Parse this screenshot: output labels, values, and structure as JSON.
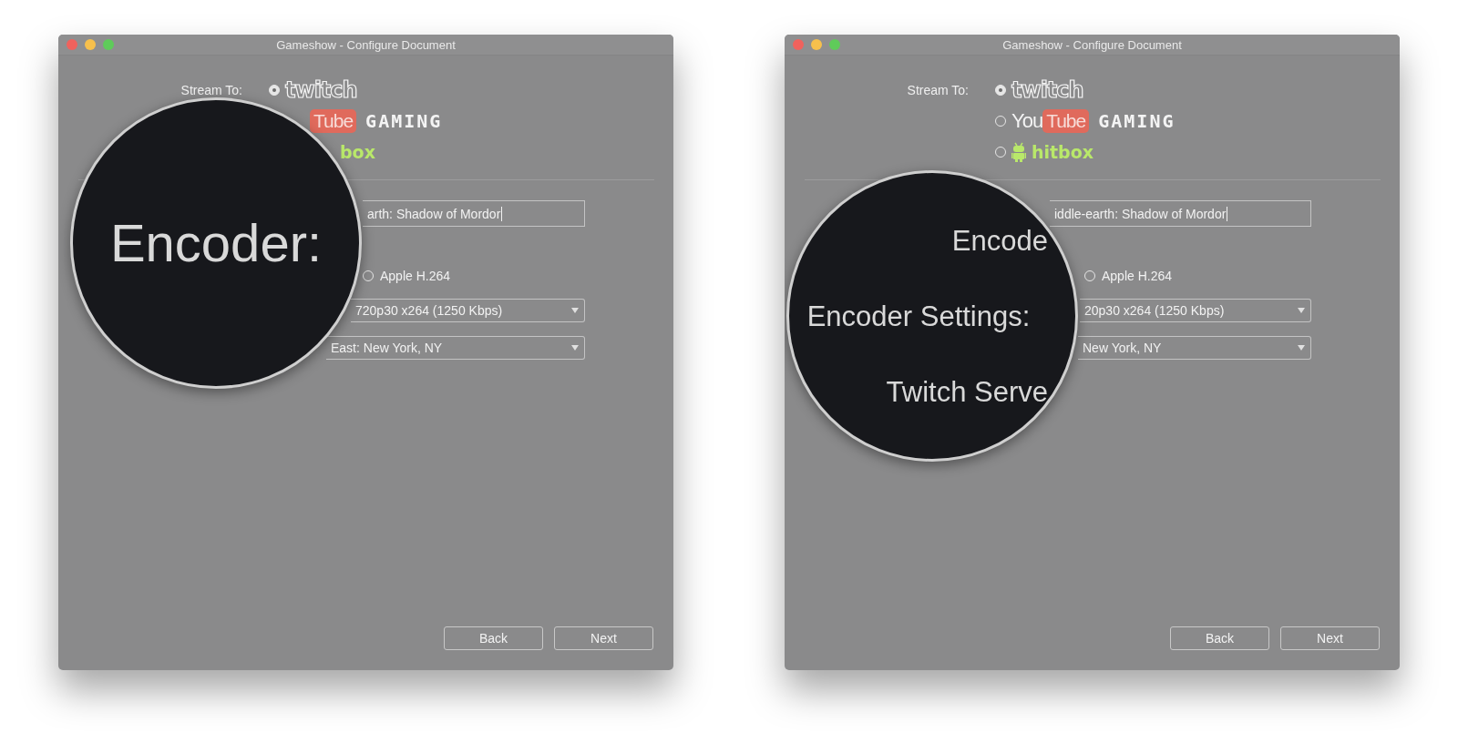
{
  "windows": [
    {
      "title": "Gameshow - Configure Document",
      "stream_label": "Stream To:",
      "services": [
        {
          "kind": "twitch",
          "selected": true,
          "logo": "twitch"
        },
        {
          "kind": "youtube",
          "tube": "Tube",
          "gaming": "GAMING"
        },
        {
          "kind": "hitbox",
          "logo": "box"
        }
      ],
      "game_field": {
        "value": "arth: Shadow of Mordor"
      },
      "encoder_option": {
        "label": "Apple H.264",
        "selected": false
      },
      "preset_select": {
        "value": "720p30 x264 (1250 Kbps)"
      },
      "server_select": {
        "value": "East: New York, NY"
      },
      "buttons": [
        "Back",
        "Next"
      ],
      "magnifier": [
        "Encoder:"
      ]
    },
    {
      "title": "Gameshow - Configure Document",
      "stream_label": "Stream To:",
      "services": [
        {
          "kind": "twitch",
          "selected": true,
          "logo": "twitch"
        },
        {
          "kind": "youtube",
          "selected": false,
          "you": "You",
          "tube": "Tube",
          "gaming": "GAMING"
        },
        {
          "kind": "hitbox",
          "selected": false,
          "logo": "hitbox"
        }
      ],
      "game_field": {
        "value": "iddle-earth: Shadow of Mordor"
      },
      "encoder_option": {
        "label": "Apple H.264",
        "selected": false
      },
      "preset_select": {
        "value": "20p30 x264 (1250 Kbps)"
      },
      "server_select": {
        "value": "New York, NY"
      },
      "buttons": [
        "Back",
        "Next"
      ],
      "magnifier": [
        "Encode",
        "Encoder Settings:",
        "Twitch Serve"
      ]
    }
  ]
}
